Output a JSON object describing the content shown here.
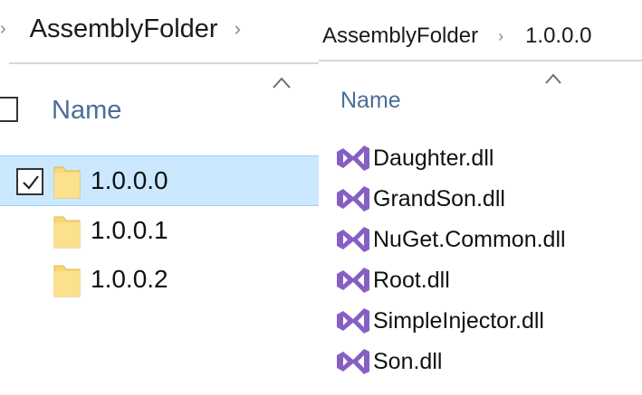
{
  "left_pane": {
    "breadcrumb": {
      "folder": "AssemblyFolder"
    },
    "column_header": "Name",
    "rows": [
      {
        "name": "1.0.0.0",
        "selected": true,
        "checked": true
      },
      {
        "name": "1.0.0.1",
        "selected": false,
        "checked": false
      },
      {
        "name": "1.0.0.2",
        "selected": false,
        "checked": false
      }
    ]
  },
  "right_pane": {
    "breadcrumb": {
      "parent": "AssemblyFolder",
      "current": "1.0.0.0"
    },
    "column_header": "Name",
    "files": [
      {
        "name": "Daughter.dll",
        "icon": "visual-studio-file-icon"
      },
      {
        "name": "GrandSon.dll",
        "icon": "visual-studio-file-icon"
      },
      {
        "name": "NuGet.Common.dll",
        "icon": "visual-studio-file-icon"
      },
      {
        "name": "Root.dll",
        "icon": "visual-studio-file-icon"
      },
      {
        "name": "SimpleInjector.dll",
        "icon": "visual-studio-file-icon"
      },
      {
        "name": "Son.dll",
        "icon": "visual-studio-file-icon"
      }
    ]
  },
  "colors": {
    "selection_background": "#cce8ff",
    "selection_border": "#99d1ff",
    "column_header_text": "#4a6d99",
    "folder_yellow": "#f8d775",
    "vs_purple": "#865fc5"
  }
}
